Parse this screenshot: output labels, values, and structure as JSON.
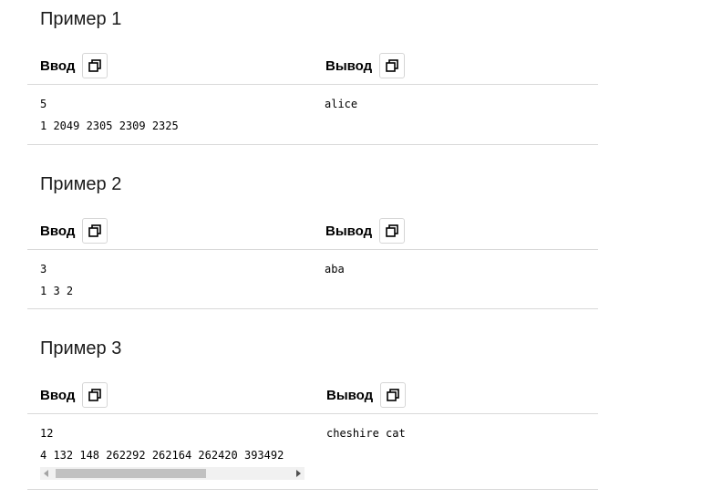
{
  "examples": [
    {
      "title": "Пример 1",
      "input_label": "Ввод",
      "output_label": "Вывод",
      "input_lines": [
        "5",
        "1 2049 2305 2309 2325"
      ],
      "output_lines": [
        "alice"
      ]
    },
    {
      "title": "Пример 2",
      "input_label": "Ввод",
      "output_label": "Вывод",
      "input_lines": [
        "3",
        "1 3 2"
      ],
      "output_lines": [
        "aba"
      ]
    },
    {
      "title": "Пример 3",
      "input_label": "Ввод",
      "output_label": "Вывод",
      "input_lines": [
        "12",
        "4 132 148 262292 262164 262420 393492"
      ],
      "output_lines": [
        "cheshire cat"
      ]
    }
  ],
  "icons": {
    "copy": "copy-icon",
    "scroll_left": "scroll-left-arrow-icon",
    "scroll_right": "scroll-right-arrow-icon"
  }
}
